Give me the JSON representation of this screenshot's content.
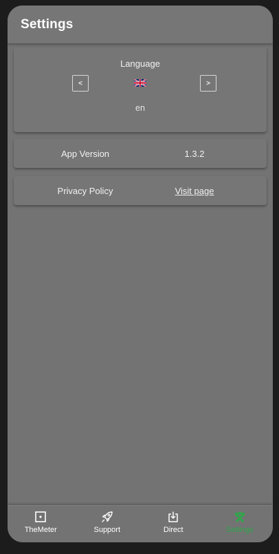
{
  "header": {
    "title": "Settings"
  },
  "language": {
    "title": "Language",
    "prev_label": "<",
    "next_label": ">",
    "flag_icon": "uk-flag-icon",
    "code": "en"
  },
  "version": {
    "label": "App Version",
    "value": "1.3.2"
  },
  "privacy": {
    "label": "Privacy Policy",
    "link": "Visit page"
  },
  "nav": {
    "items": [
      {
        "label": "TheMeter",
        "icon": "meter-icon"
      },
      {
        "label": "Support",
        "icon": "rocket-icon"
      },
      {
        "label": "Direct",
        "icon": "download-icon"
      },
      {
        "label": "Settings",
        "icon": "tools-icon",
        "active": true
      }
    ]
  },
  "colors": {
    "active": "#2ea84a",
    "surface": "#737373"
  }
}
